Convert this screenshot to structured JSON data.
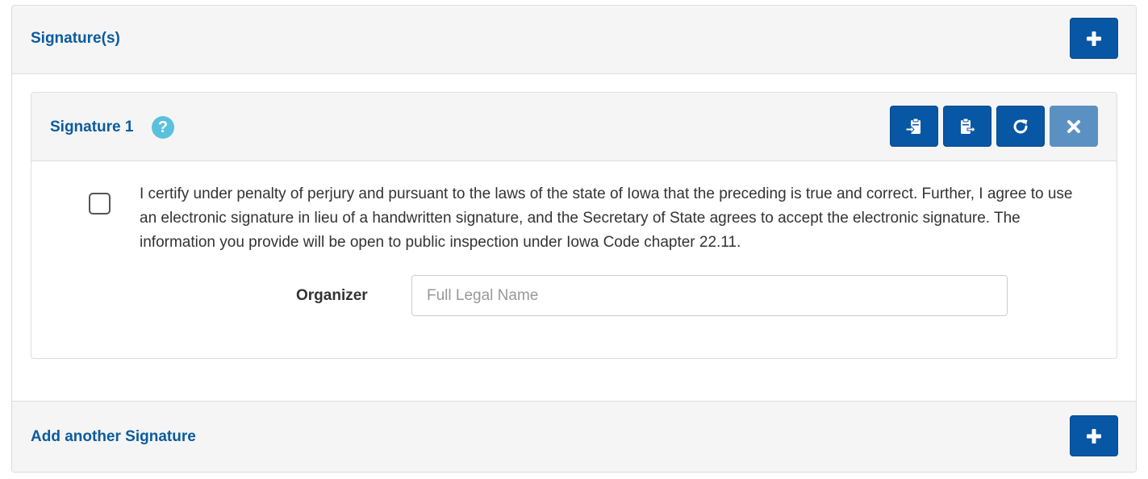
{
  "signatures_panel": {
    "title": "Signature(s)",
    "add_icon": "plus-icon"
  },
  "signature": {
    "title": "Signature 1",
    "help_icon": "question-circle-icon",
    "help_glyph": "?",
    "tools": [
      {
        "icon": "copy-to-clipboard-icon"
      },
      {
        "icon": "paste-from-clipboard-icon"
      },
      {
        "icon": "refresh-icon"
      },
      {
        "icon": "remove-icon"
      }
    ],
    "certify_checked": false,
    "certify_text": "I certify under penalty of perjury and pursuant to the laws of the state of Iowa that the preceding is true and correct. Further, I agree to use an electronic signature in lieu of a handwritten signature, and the Secretary of State agrees to accept the electronic signature. The information you provide will be open to public inspection under Iowa Code chapter 22.11.",
    "organizer_label": "Organizer",
    "name_value": "",
    "name_placeholder": "Full Legal Name"
  },
  "footer": {
    "title": "Add another Signature",
    "add_icon": "plus-icon"
  },
  "colors": {
    "primary": "#0857a5",
    "primary_disabled": "#5b91c2",
    "heading_text": "#0b5b9e",
    "help": "#5bc0de",
    "panel_bg": "#f5f5f5"
  }
}
